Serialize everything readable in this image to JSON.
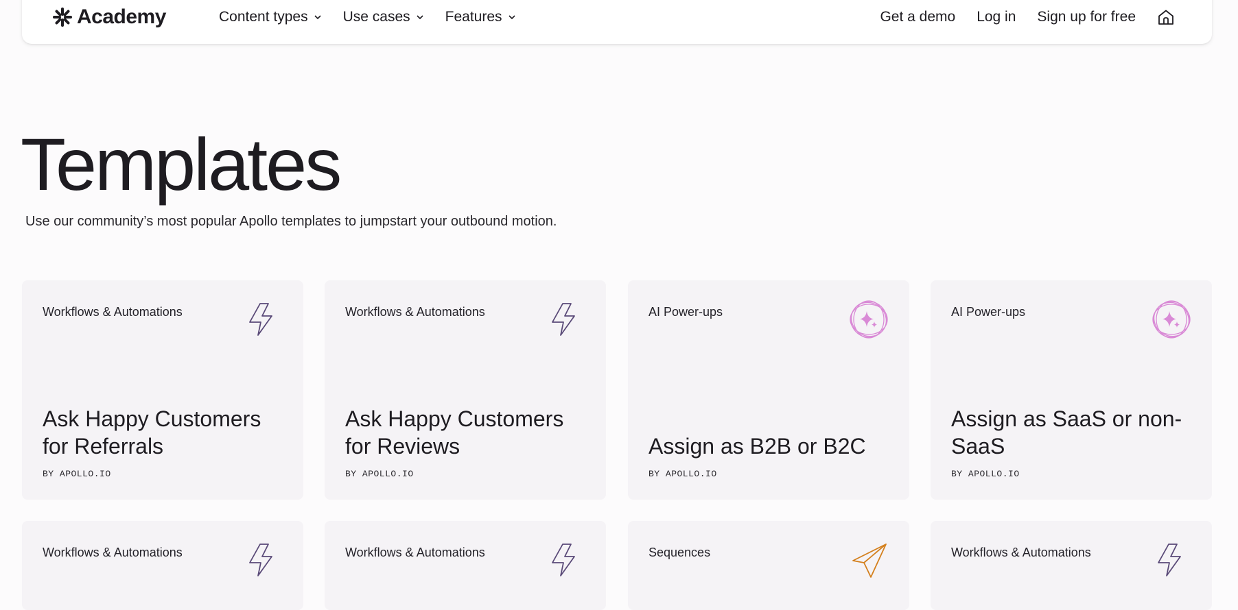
{
  "header": {
    "logo_text": "Academy",
    "nav": [
      {
        "label": "Content types"
      },
      {
        "label": "Use cases"
      },
      {
        "label": "Features"
      }
    ],
    "get_demo": "Get a demo",
    "log_in": "Log in",
    "sign_up": "Sign up for free"
  },
  "page": {
    "title": "Templates",
    "subtitle": "Use our community’s most popular Apollo templates to jumpstart your outbound motion."
  },
  "cards": [
    {
      "category": "Workflows & Automations",
      "icon": "lightning-icon",
      "title": "Ask Happy Customers for Referrals",
      "author": "BY APOLLO.IO"
    },
    {
      "category": "Workflows & Automations",
      "icon": "lightning-icon",
      "title": "Ask Happy Customers for Reviews",
      "author": "BY APOLLO.IO"
    },
    {
      "category": "AI Power-ups",
      "icon": "sparkle-icon",
      "title": "Assign as B2B or B2C",
      "author": "BY APOLLO.IO"
    },
    {
      "category": "AI Power-ups",
      "icon": "sparkle-icon",
      "title": "Assign as SaaS or non-SaaS",
      "author": "BY APOLLO.IO"
    },
    {
      "category": "Workflows & Automations",
      "icon": "lightning-icon"
    },
    {
      "category": "Workflows & Automations",
      "icon": "lightning-icon"
    },
    {
      "category": "Sequences",
      "icon": "paper-plane-icon"
    },
    {
      "category": "Workflows & Automations",
      "icon": "lightning-icon"
    }
  ],
  "colors": {
    "lightning": "#5a4a78",
    "sparkle": "#d98ad6",
    "paper_plane": "#d4801e",
    "card_bg": "#f5f3f6"
  }
}
